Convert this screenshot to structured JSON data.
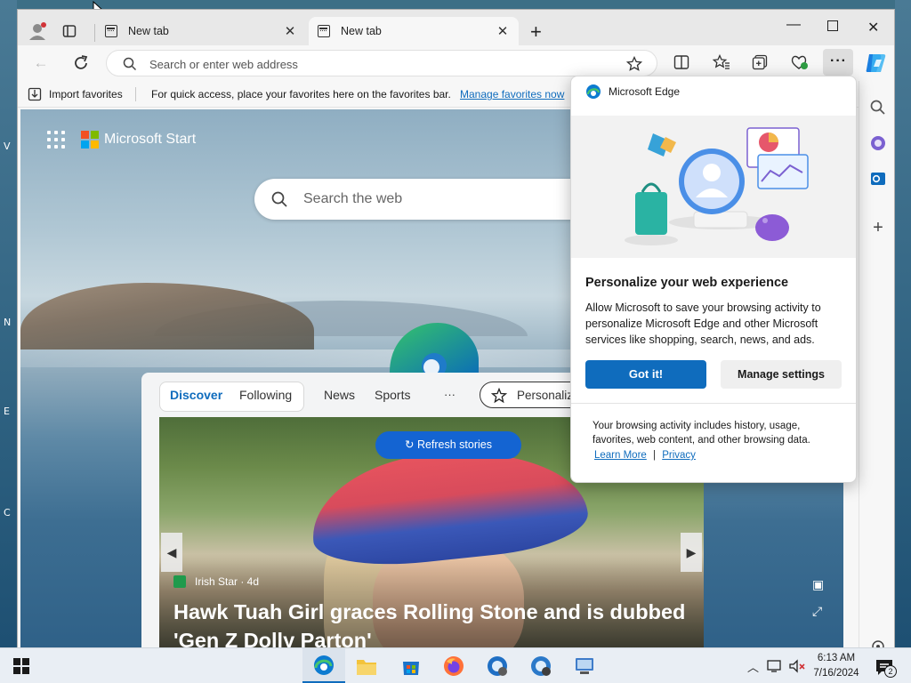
{
  "desktop": {
    "edge_letters": [
      "V",
      "N",
      "E",
      "C"
    ]
  },
  "tabs": [
    {
      "title": "New tab",
      "active": false
    },
    {
      "title": "New tab",
      "active": true
    }
  ],
  "address_bar": {
    "placeholder": "Search or enter web address"
  },
  "favorites_bar": {
    "import_label": "Import favorites",
    "hint": "For quick access, place your favorites here on the favorites bar.",
    "manage_link": "Manage favorites now"
  },
  "start_page": {
    "brand": "Microsoft Start",
    "search_placeholder": "Search the web",
    "feed_tabs": [
      "Discover",
      "Following"
    ],
    "feed_nav": [
      "News",
      "Sports",
      "···"
    ],
    "personalize_label": "Personaliz",
    "refresh_label": "Refresh stories",
    "story": {
      "source": "Irish Star · 4d",
      "headline": "Hawk Tuah Girl graces Rolling Stone and is dubbed 'Gen Z Dolly Parton'"
    }
  },
  "popover": {
    "brand": "Microsoft Edge",
    "title": "Personalize your web experience",
    "body": "Allow Microsoft to save your browsing activity to personalize Microsoft Edge and other Microsoft services like shopping, search, news, and ads.",
    "primary_button": "Got it!",
    "secondary_button": "Manage settings",
    "footer": "Your browsing activity includes history, usage, favorites, web content, and other browsing data.",
    "learn_more": "Learn More",
    "separator": "|",
    "privacy": "Privacy"
  },
  "taskbar": {
    "time": "6:13 AM",
    "date": "7/16/2024",
    "notification_count": "2"
  },
  "colors": {
    "accent": "#0f6cbd",
    "refresh_button": "#1464d2",
    "ms_logo": [
      "#f25022",
      "#7fba00",
      "#00a4ef",
      "#ffb900"
    ]
  }
}
